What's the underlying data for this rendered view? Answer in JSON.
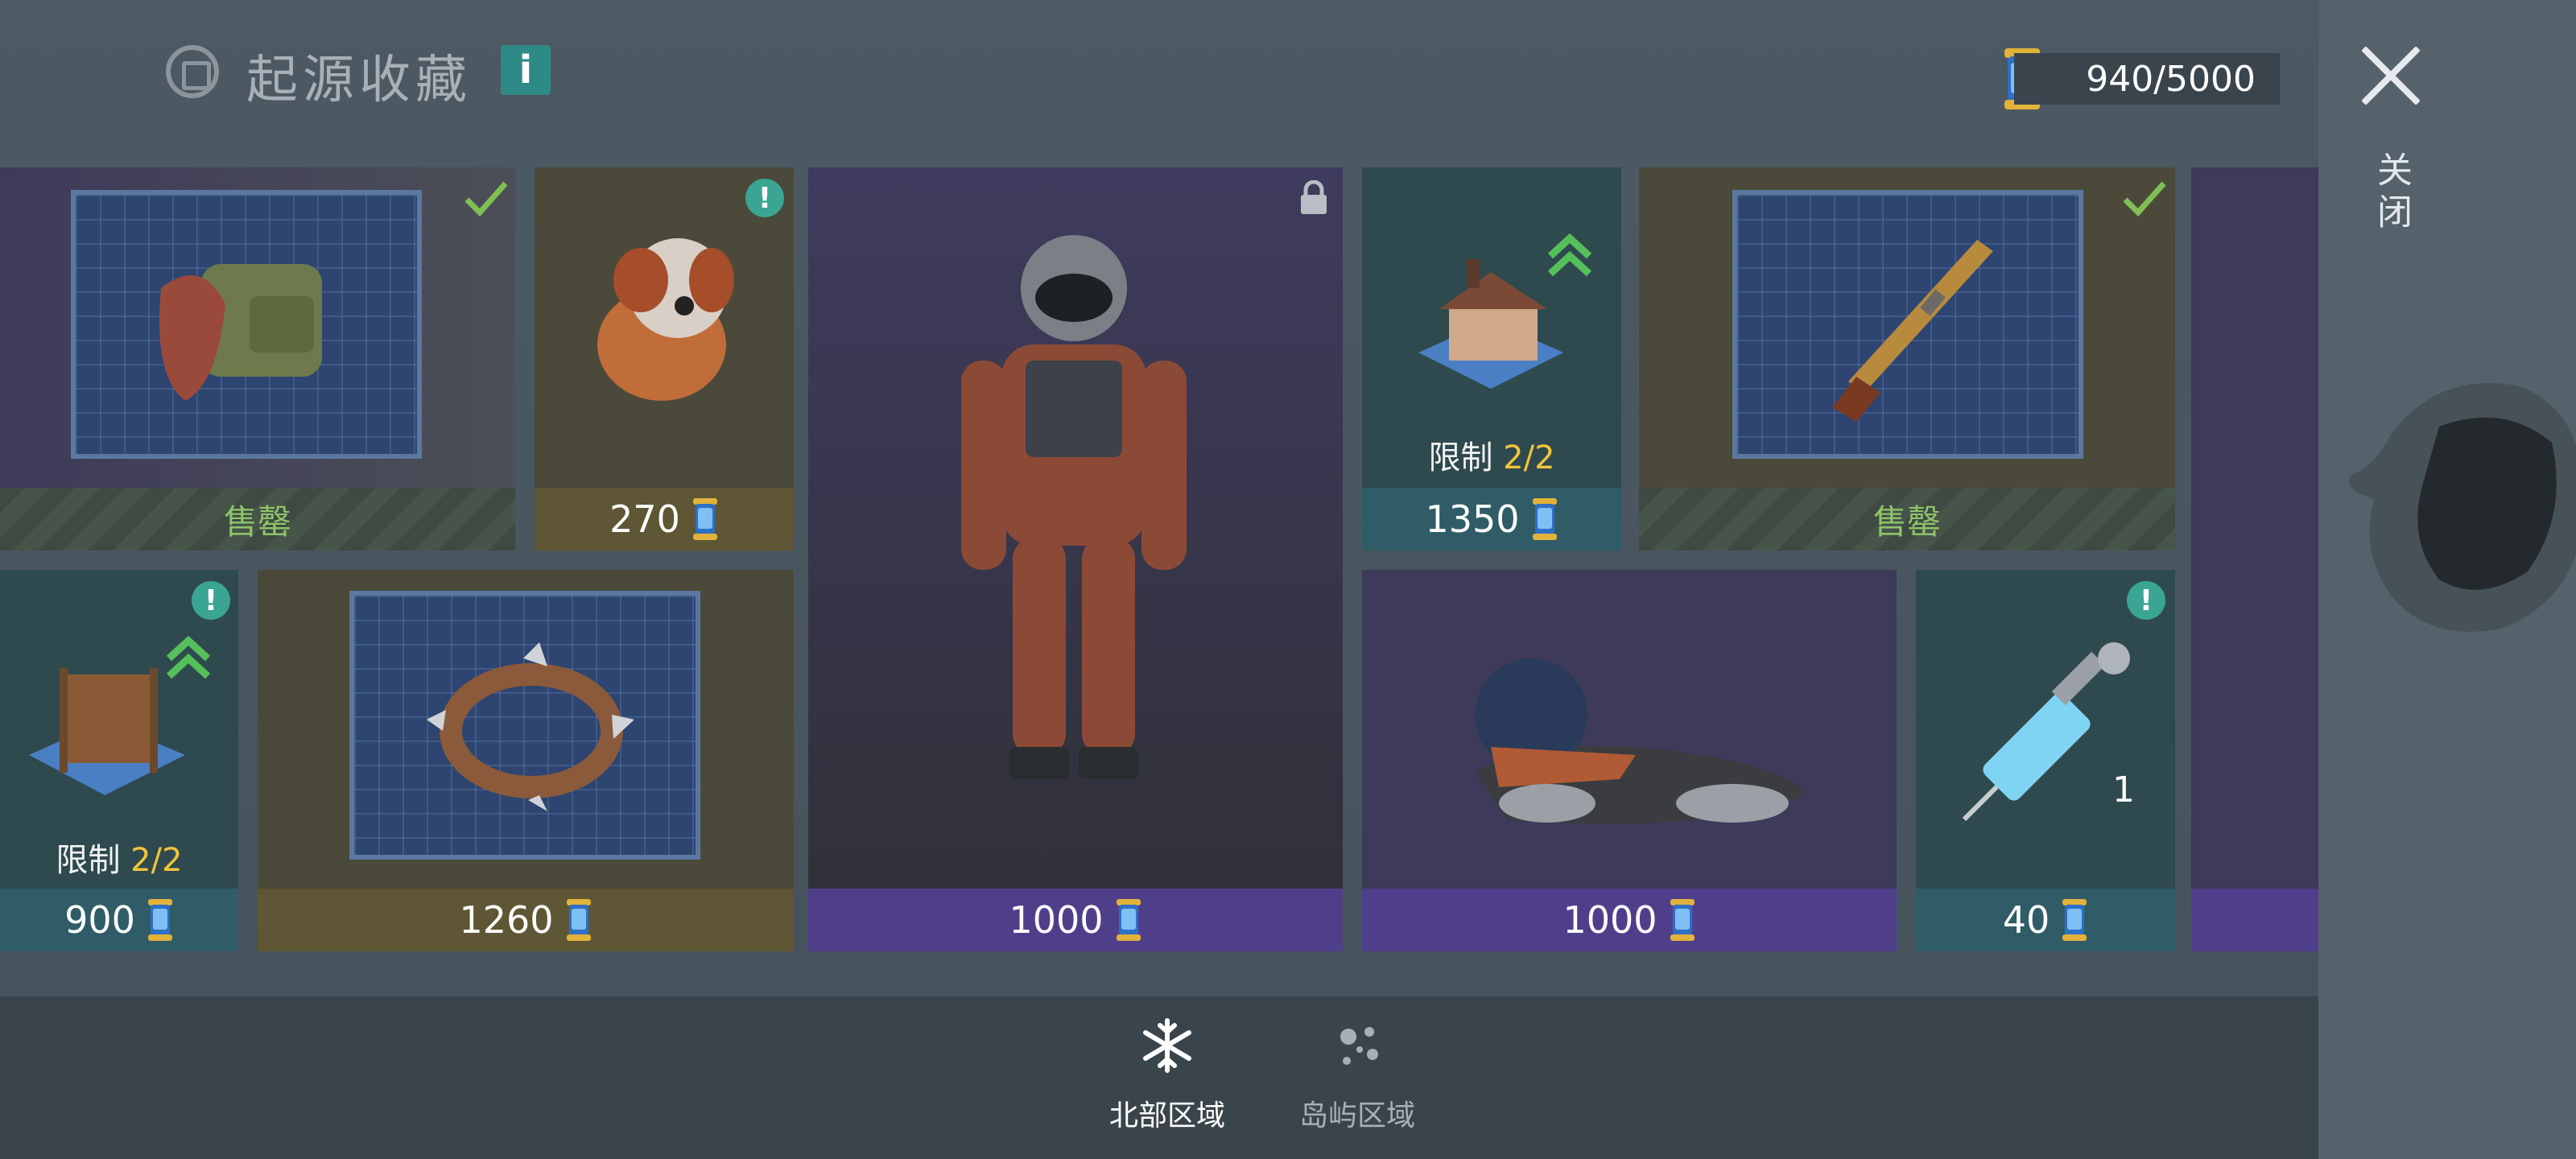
{
  "header": {
    "title": "起源收藏",
    "info_label": "i"
  },
  "currency": {
    "amount": "940/5000"
  },
  "side": {
    "close_label": "关闭"
  },
  "cards": {
    "backpack": {
      "status": "售罄"
    },
    "dog": {
      "price": "270"
    },
    "suit": {
      "price": "1000"
    },
    "house": {
      "limit_label": "限制",
      "limit_value": "2/2",
      "price": "1350"
    },
    "rifle": {
      "status": "售罄"
    },
    "frame": {
      "limit_label": "限制",
      "limit_value": "2/2",
      "price": "900"
    },
    "collar": {
      "price": "1260"
    },
    "vehicle": {
      "price": "1000"
    },
    "syringe": {
      "count": "1",
      "price": "40"
    }
  },
  "tabs": [
    {
      "label": "北部区域",
      "active": true
    },
    {
      "label": "岛屿区域",
      "active": false
    }
  ],
  "colors": {
    "purple_card": "#3e3a5a",
    "olive_card": "#4b4a3a",
    "teal_card": "#2f4a4e",
    "price_purple": "#4f3f8a",
    "price_olive": "#5e5634",
    "price_teal": "#2f5c66",
    "accent_yellow": "#f2c43a",
    "accent_green": "#8fc36a"
  }
}
